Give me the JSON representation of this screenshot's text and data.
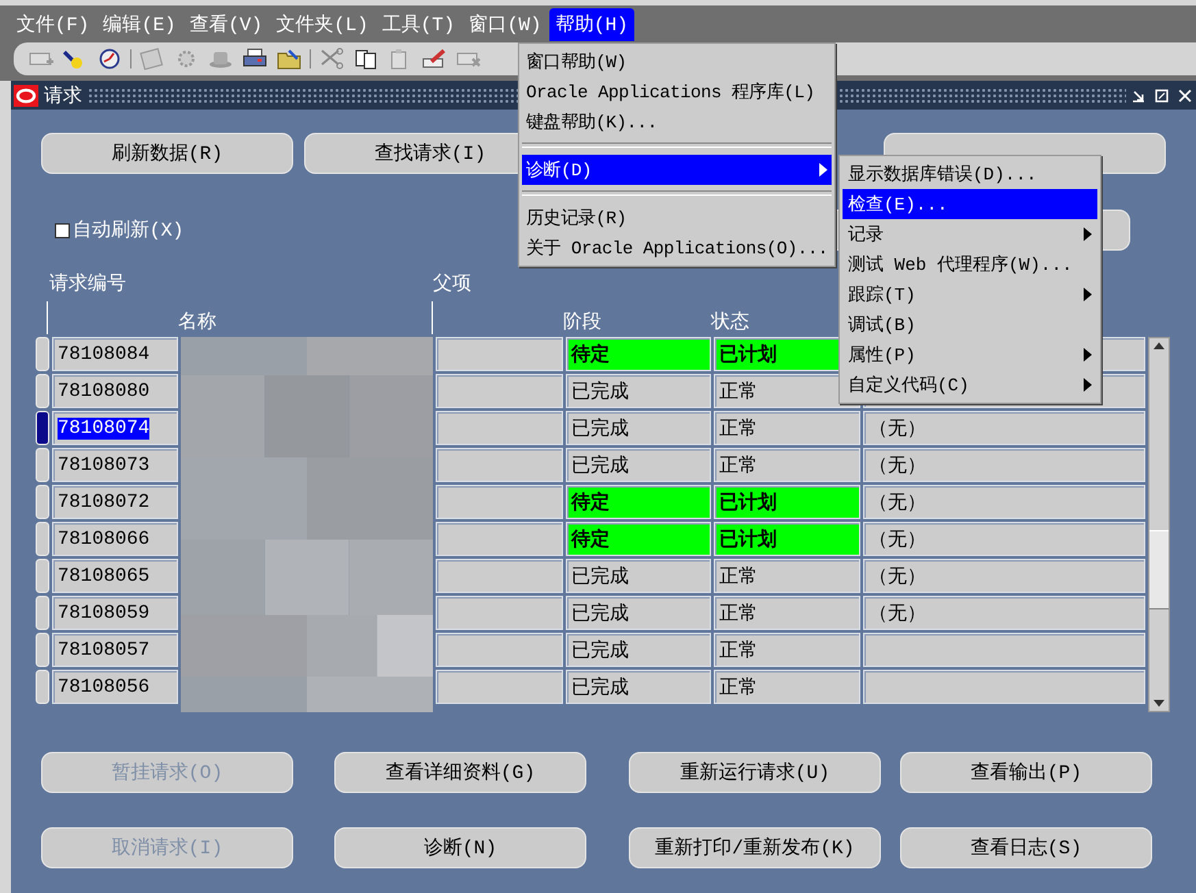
{
  "menubar": [
    {
      "label": "文件(F)",
      "selected": false
    },
    {
      "label": "编辑(E)",
      "selected": false
    },
    {
      "label": "查看(V)",
      "selected": false
    },
    {
      "label": "文件夹(L)",
      "selected": false
    },
    {
      "label": "工具(T)",
      "selected": false
    },
    {
      "label": "窗口(W)",
      "selected": false
    },
    {
      "label": "帮助(H)",
      "selected": true
    }
  ],
  "window": {
    "title": "请求"
  },
  "top_buttons": [
    {
      "label": "刷新数据(R)"
    },
    {
      "label": "查找请求(I)"
    }
  ],
  "auto_refresh": {
    "label": "自动刷新(X)",
    "checked": false
  },
  "table": {
    "columns": {
      "request_id": "请求编号",
      "name": "名称",
      "parent": "父项",
      "phase": "阶段",
      "status": "状态"
    },
    "rows": [
      {
        "request_id": "78108084",
        "selected": false,
        "phase": "待定",
        "status": "已计划",
        "highlight": true
      },
      {
        "request_id": "78108080",
        "selected": false,
        "phase": "已完成",
        "status": "正常",
        "highlight": false
      },
      {
        "request_id": "78108074",
        "selected": true,
        "phase": "已完成",
        "status": "正常",
        "highlight": false,
        "column_6": "（无）"
      },
      {
        "request_id": "78108073",
        "selected": false,
        "phase": "已完成",
        "status": "正常",
        "highlight": false,
        "column_6": "（无）"
      },
      {
        "request_id": "78108072",
        "selected": false,
        "phase": "待定",
        "status": "已计划",
        "highlight": true,
        "column_6": "（无）"
      },
      {
        "request_id": "78108066",
        "selected": false,
        "phase": "待定",
        "status": "已计划",
        "highlight": true,
        "column_6": "（无）"
      },
      {
        "request_id": "78108065",
        "selected": false,
        "phase": "已完成",
        "status": "正常",
        "highlight": false,
        "column_6": "（无）"
      },
      {
        "request_id": "78108059",
        "selected": false,
        "phase": "已完成",
        "status": "正常",
        "highlight": false,
        "column_6": "（无）"
      },
      {
        "request_id": "78108057",
        "selected": false,
        "phase": "已完成",
        "status": "正常",
        "highlight": false
      },
      {
        "request_id": "78108056",
        "selected": false,
        "phase": "已完成",
        "status": "正常",
        "highlight": false
      }
    ]
  },
  "bottom_buttons": [
    {
      "label": "暂挂请求(O)",
      "disabled": true
    },
    {
      "label": "查看详细资料(G)",
      "disabled": false
    },
    {
      "label": "重新运行请求(U)",
      "disabled": false
    },
    {
      "label": "查看输出(P)",
      "disabled": false
    },
    {
      "label": "取消请求(I)",
      "disabled": true
    },
    {
      "label": "诊断(N)",
      "disabled": false
    },
    {
      "label": "重新打印/重新发布(K)",
      "disabled": false
    },
    {
      "label": "查看日志(S)",
      "disabled": false
    }
  ],
  "help_menu": {
    "items": [
      {
        "kind": "item",
        "label": "窗口帮助(W)",
        "selected": false,
        "has_submenu": false
      },
      {
        "kind": "item",
        "label": "Oracle Applications 程序库(L)",
        "selected": false,
        "has_submenu": false
      },
      {
        "kind": "item",
        "label": "键盘帮助(K)...",
        "selected": false,
        "has_submenu": false
      },
      {
        "kind": "separator"
      },
      {
        "kind": "item",
        "label": "诊断(D)",
        "selected": true,
        "has_submenu": true
      },
      {
        "kind": "separator"
      },
      {
        "kind": "item",
        "label": "历史记录(R)",
        "selected": false,
        "has_submenu": false
      },
      {
        "kind": "item",
        "label": "关于 Oracle Applications(O)...",
        "selected": false
      }
    ]
  },
  "diagnostics_submenu": {
    "items": [
      {
        "kind": "item",
        "label": "显示数据库错误(D)...",
        "selected": false,
        "has_submenu": false
      },
      {
        "kind": "item",
        "label": "检查(E)...",
        "selected": true,
        "has_submenu": false
      },
      {
        "kind": "item",
        "label": "记录",
        "selected": false,
        "has_submenu": true
      },
      {
        "kind": "item",
        "label": "测试 Web 代理程序(W)...",
        "selected": false,
        "has_submenu": false
      },
      {
        "kind": "item",
        "label": "跟踪(T)",
        "selected": false,
        "has_submenu": true
      },
      {
        "kind": "item",
        "label": "调试(B)",
        "selected": false,
        "has_submenu": false
      },
      {
        "kind": "item",
        "label": "属性(P)",
        "selected": false,
        "has_submenu": true
      },
      {
        "kind": "item",
        "label": "自定义代码(C)",
        "selected": false,
        "has_submenu": true
      }
    ]
  }
}
